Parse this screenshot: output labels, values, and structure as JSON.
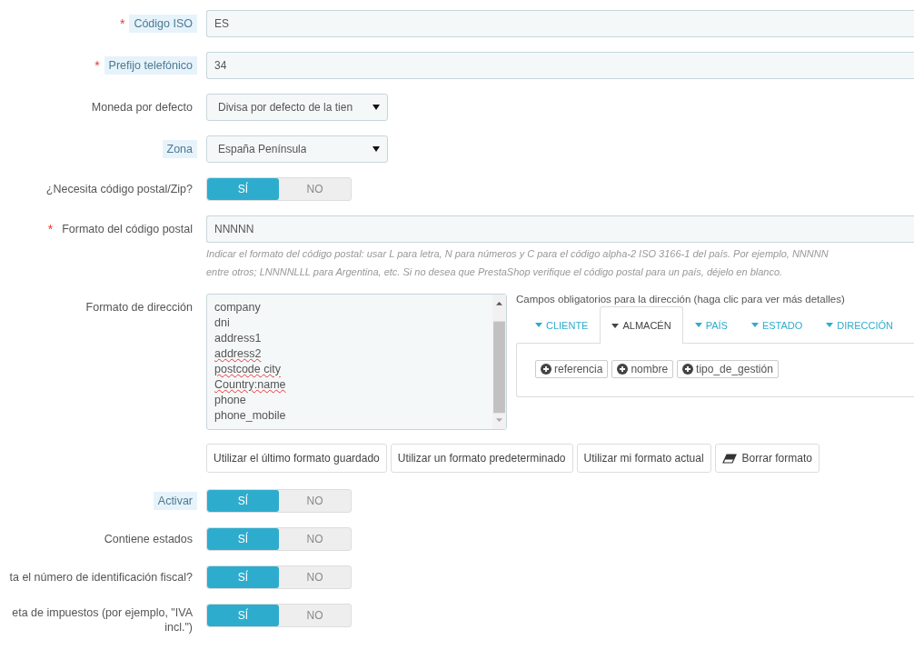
{
  "fields": [
    {
      "kind": "text",
      "label": "Código ISO",
      "required_mark": "*",
      "hint": true,
      "value": "ES"
    },
    {
      "kind": "text",
      "label": "Prefijo telefónico",
      "required_mark": "*",
      "hint": true,
      "value": "34"
    },
    {
      "kind": "select",
      "label": "Moneda por defecto",
      "hint": false,
      "value": "Divisa por defecto de la tien"
    },
    {
      "kind": "select",
      "label": "Zona",
      "hint": true,
      "value": "España Península"
    },
    {
      "kind": "switch",
      "label": "¿Necesita código postal/Zip?",
      "hint": false,
      "on": true,
      "on_label": "SÍ",
      "off_label": "NO"
    },
    {
      "kind": "text",
      "label": "Formato del código postal",
      "required_mark": "*",
      "hint": false,
      "value": "NNNNN",
      "help": [
        "Indicar el formato del código postal: usar L para letra, N para números y C para el código alpha-2 ISO 3166-1 del país. Por ejemplo, NNNNN",
        "entre otros; LNNNNLLL para Argentina, etc. Si no desea que PrestaShop verifique el código postal para un país, déjelo en blanco."
      ]
    },
    {
      "kind": "address",
      "label": "Formato de dirección",
      "hint": false,
      "lines": [
        {
          "text": "company",
          "misspelled": false
        },
        {
          "text": "dni",
          "misspelled": false
        },
        {
          "text": "address1",
          "misspelled": false
        },
        {
          "text": "address2",
          "misspelled": true
        },
        {
          "text": "postcode city",
          "misspelled": true
        },
        {
          "text": "Country:name",
          "misspelled": true
        },
        {
          "text": "phone",
          "misspelled": false
        },
        {
          "text": "phone_mobile",
          "misspelled": false
        }
      ],
      "fields_title": "Campos obligatorios para la dirección (haga clic para ver más detalles)",
      "tabs": [
        {
          "label": "CLIENTE",
          "selected": false
        },
        {
          "label": "ALMACÉN",
          "selected": true
        },
        {
          "label": "PAÍS",
          "selected": false
        },
        {
          "label": "ESTADO",
          "selected": false
        },
        {
          "label": "DIRECCIÓN",
          "selected": false
        }
      ],
      "chips": [
        "referencia",
        "nombre",
        "tipo_de_gestión"
      ],
      "buttons": [
        {
          "label": "Utilizar el último formato guardado",
          "kind": "plain"
        },
        {
          "label": "Utilizar un formato predeterminado",
          "kind": "plain"
        },
        {
          "label": "Utilizar mi formato actual",
          "kind": "plain"
        },
        {
          "label": "Borrar formato",
          "kind": "eraser"
        }
      ]
    },
    {
      "kind": "switch",
      "label": "Activar",
      "hint": true,
      "on": true,
      "on_label": "SÍ",
      "off_label": "NO"
    },
    {
      "kind": "switch",
      "label": "Contiene estados",
      "hint": false,
      "on": true,
      "on_label": "SÍ",
      "off_label": "NO"
    },
    {
      "kind": "switch",
      "label": "ta el número de identificación fiscal?",
      "hint": false,
      "on": true,
      "on_label": "SÍ",
      "off_label": "NO"
    },
    {
      "kind": "switch",
      "label": "eta de impuestos (por ejemplo, \"IVA incl.\")",
      "hint": false,
      "on": true,
      "on_label": "SÍ",
      "off_label": "NO"
    }
  ]
}
